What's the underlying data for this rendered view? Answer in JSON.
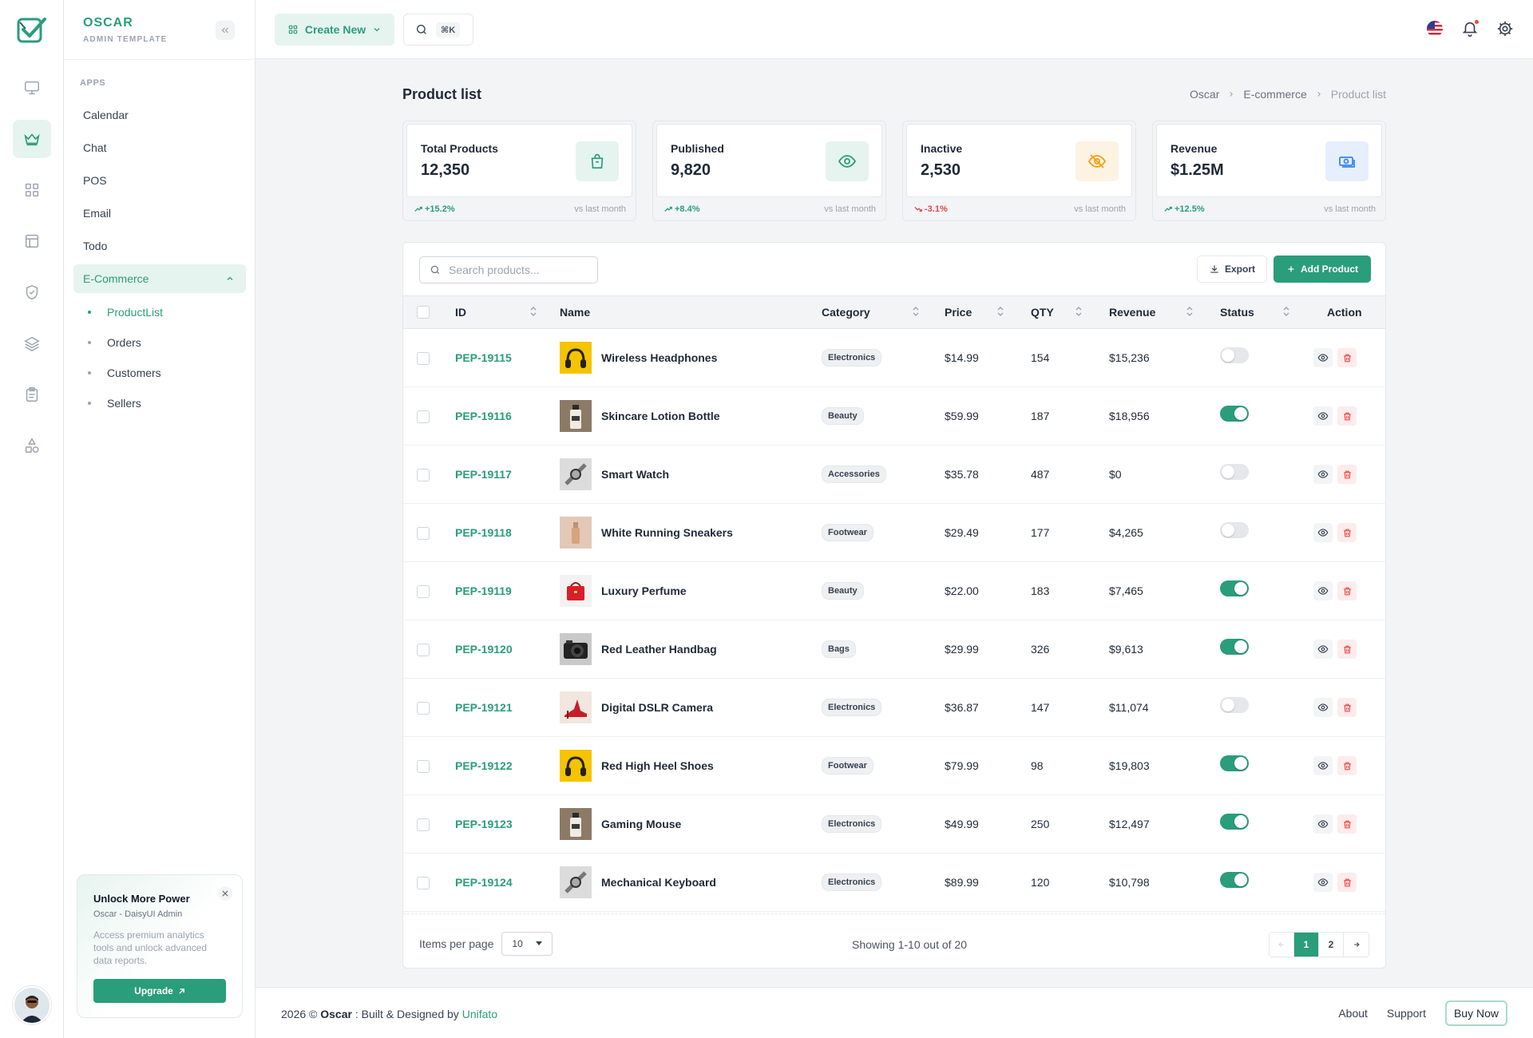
{
  "brand": {
    "name": "OSCAR",
    "tagline": "ADMIN TEMPLATE"
  },
  "rail": {
    "icons": [
      "monitor-icon",
      "crown-icon",
      "grid-icon",
      "layout-icon",
      "shield-check-icon",
      "layers-icon",
      "clipboard-icon",
      "shapes-icon"
    ],
    "active": "crown-icon"
  },
  "sidebar": {
    "section_label": "APPS",
    "items": [
      {
        "label": "Calendar"
      },
      {
        "label": "Chat"
      },
      {
        "label": "POS"
      },
      {
        "label": "Email"
      },
      {
        "label": "Todo"
      },
      {
        "label": "E-Commerce"
      }
    ],
    "sub_items": [
      {
        "label": "ProductList"
      },
      {
        "label": "Orders"
      },
      {
        "label": "Customers"
      },
      {
        "label": "Sellers"
      }
    ],
    "promo": {
      "title": "Unlock More Power",
      "subtitle": "Oscar - DaisyUI Admin",
      "description": "Access premium analytics tools and unlock advanced data reports.",
      "button": "Upgrade"
    }
  },
  "topbar": {
    "create_label": "Create New",
    "shortcut": "⌘K"
  },
  "page": {
    "title": "Product list",
    "breadcrumb": [
      "Oscar",
      "E-commerce",
      "Product list"
    ]
  },
  "stats": [
    {
      "label": "Total Products",
      "value": "12,350",
      "change": "+15.2%",
      "trend": "up",
      "note": "vs last month",
      "icon": "shopping-bag-icon",
      "color": "#2a9d7a",
      "bg": "#e6f4ef"
    },
    {
      "label": "Published",
      "value": "9,820",
      "change": "+8.4%",
      "trend": "up",
      "note": "vs last month",
      "icon": "eye-icon",
      "color": "#2a9d7a",
      "bg": "#e6f4ef"
    },
    {
      "label": "Inactive",
      "value": "2,530",
      "change": "-3.1%",
      "trend": "down",
      "note": "vs last month",
      "icon": "eye-off-icon",
      "color": "#f59e0b",
      "bg": "#fdf3e3"
    },
    {
      "label": "Revenue",
      "value": "$1.25M",
      "change": "+12.5%",
      "trend": "up",
      "note": "vs last month",
      "icon": "money-icon",
      "color": "#3b82f6",
      "bg": "#e5effd"
    }
  ],
  "toolbar": {
    "search_placeholder": "Search products...",
    "export_label": "Export",
    "add_label": "Add Product"
  },
  "table": {
    "columns": [
      "ID",
      "Name",
      "Category",
      "Price",
      "QTY",
      "Revenue",
      "Status",
      "Action"
    ],
    "rows": [
      {
        "id": "PEP-19115",
        "name": "Wireless Headphones",
        "category": "Electronics",
        "price": "$14.99",
        "qty": "154",
        "revenue": "$15,236",
        "status": false,
        "thumb": "headphones"
      },
      {
        "id": "PEP-19116",
        "name": "Skincare Lotion Bottle",
        "category": "Beauty",
        "price": "$59.99",
        "qty": "187",
        "revenue": "$18,956",
        "status": true,
        "thumb": "bottle"
      },
      {
        "id": "PEP-19117",
        "name": "Smart Watch",
        "category": "Accessories",
        "price": "$35.78",
        "qty": "487",
        "revenue": "$0",
        "status": false,
        "thumb": "watch"
      },
      {
        "id": "PEP-19118",
        "name": "White Running Sneakers",
        "category": "Footwear",
        "price": "$29.49",
        "qty": "177",
        "revenue": "$4,265",
        "status": false,
        "thumb": "perfume"
      },
      {
        "id": "PEP-19119",
        "name": "Luxury Perfume",
        "category": "Beauty",
        "price": "$22.00",
        "qty": "183",
        "revenue": "$7,465",
        "status": true,
        "thumb": "redbag"
      },
      {
        "id": "PEP-19120",
        "name": "Red Leather Handbag",
        "category": "Bags",
        "price": "$29.99",
        "qty": "326",
        "revenue": "$9,613",
        "status": true,
        "thumb": "camera"
      },
      {
        "id": "PEP-19121",
        "name": "Digital DSLR Camera",
        "category": "Electronics",
        "price": "$36.87",
        "qty": "147",
        "revenue": "$11,074",
        "status": false,
        "thumb": "heels"
      },
      {
        "id": "PEP-19122",
        "name": "Red High Heel Shoes",
        "category": "Footwear",
        "price": "$79.99",
        "qty": "98",
        "revenue": "$19,803",
        "status": true,
        "thumb": "headphones"
      },
      {
        "id": "PEP-19123",
        "name": "Gaming Mouse",
        "category": "Electronics",
        "price": "$49.99",
        "qty": "250",
        "revenue": "$12,497",
        "status": true,
        "thumb": "bottle"
      },
      {
        "id": "PEP-19124",
        "name": "Mechanical Keyboard",
        "category": "Electronics",
        "price": "$89.99",
        "qty": "120",
        "revenue": "$10,798",
        "status": true,
        "thumb": "watch"
      }
    ]
  },
  "pagination": {
    "items_per_page_label": "Items per page",
    "per_page": "10",
    "showing": "Showing 1-10 out of 20",
    "pages": [
      "1",
      "2"
    ],
    "current": "1"
  },
  "footer": {
    "year": "2026 ©",
    "brand": "Oscar",
    "built": ": Built & Designed by",
    "author": "Unifato",
    "links": [
      "About",
      "Support"
    ],
    "buy": "Buy Now"
  },
  "colors": {
    "accent": "#2a9d7a",
    "danger": "#ef4444"
  }
}
